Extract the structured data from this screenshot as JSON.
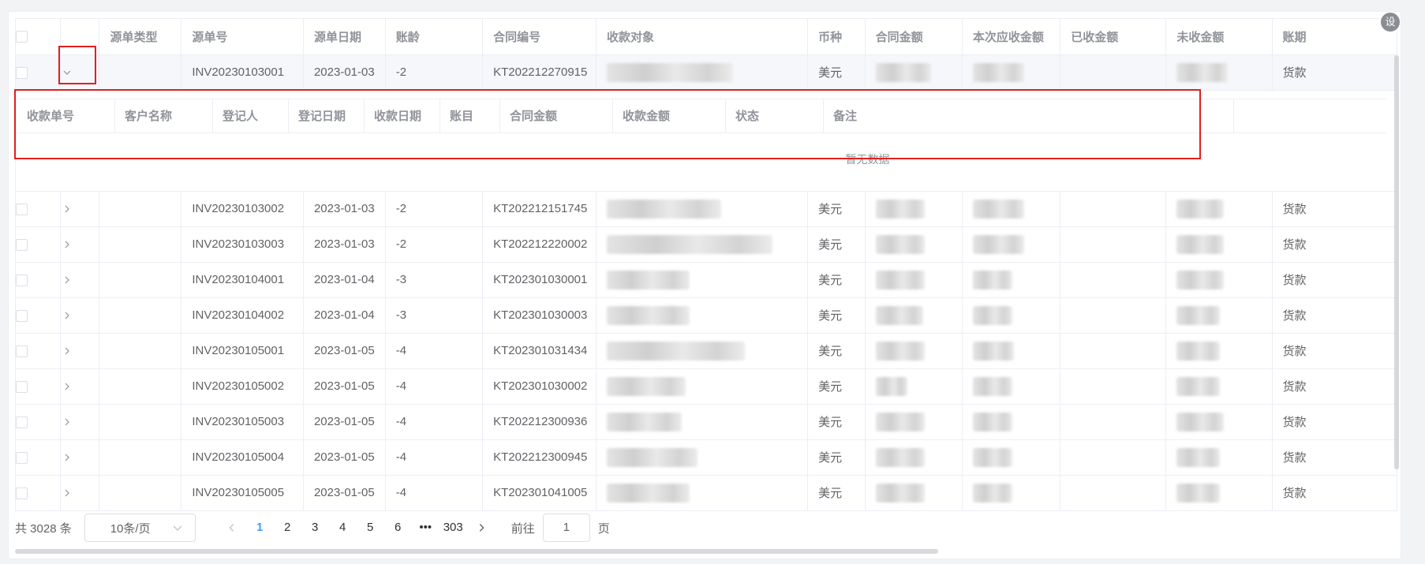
{
  "columns": [
    "源单类型",
    "源单号",
    "源单日期",
    "账龄",
    "合同编号",
    "收款对象",
    "币种",
    "合同金额",
    "本次应收金额",
    "已收金额",
    "未收金额",
    "账期"
  ],
  "rows": [
    {
      "source_no": "INV20230103001",
      "date": "2023-01-03",
      "aging": "-2",
      "contract": "KT202212270915",
      "currency": "美元",
      "account": "货款",
      "expanded": true
    },
    {
      "source_no": "INV20230103002",
      "date": "2023-01-03",
      "aging": "-2",
      "contract": "KT202212151745",
      "currency": "美元",
      "account": "货款",
      "expanded": false
    },
    {
      "source_no": "INV20230103003",
      "date": "2023-01-03",
      "aging": "-2",
      "contract": "KT202212220002",
      "currency": "美元",
      "account": "货款",
      "expanded": false
    },
    {
      "source_no": "INV20230104001",
      "date": "2023-01-04",
      "aging": "-3",
      "contract": "KT202301030001",
      "currency": "美元",
      "account": "货款",
      "expanded": false
    },
    {
      "source_no": "INV20230104002",
      "date": "2023-01-04",
      "aging": "-3",
      "contract": "KT202301030003",
      "currency": "美元",
      "account": "货款",
      "expanded": false
    },
    {
      "source_no": "INV20230105001",
      "date": "2023-01-05",
      "aging": "-4",
      "contract": "KT202301031434",
      "currency": "美元",
      "account": "货款",
      "expanded": false
    },
    {
      "source_no": "INV20230105002",
      "date": "2023-01-05",
      "aging": "-4",
      "contract": "KT202301030002",
      "currency": "美元",
      "account": "货款",
      "expanded": false
    },
    {
      "source_no": "INV20230105003",
      "date": "2023-01-05",
      "aging": "-4",
      "contract": "KT202212300936",
      "currency": "美元",
      "account": "货款",
      "expanded": false
    },
    {
      "source_no": "INV20230105004",
      "date": "2023-01-05",
      "aging": "-4",
      "contract": "KT202212300945",
      "currency": "美元",
      "account": "货款",
      "expanded": false
    },
    {
      "source_no": "INV20230105005",
      "date": "2023-01-05",
      "aging": "-4",
      "contract": "KT202301041005",
      "currency": "美元",
      "account": "货款",
      "expanded": false
    }
  ],
  "sub_table": {
    "columns": [
      "收款单号",
      "客户名称",
      "登记人",
      "登记日期",
      "收款日期",
      "账目",
      "合同金额",
      "收款金额",
      "状态",
      "备注"
    ],
    "empty_text": "暂无数据"
  },
  "pagination": {
    "total": "共 3028 条",
    "page_size": "10条/页",
    "pages": [
      "1",
      "2",
      "3",
      "4",
      "5",
      "6"
    ],
    "ellipsis": "•••",
    "last_page": "303",
    "active": "1",
    "goto_prefix": "前往",
    "goto_value": "1",
    "goto_suffix": "页"
  },
  "corner_icon_label": "设"
}
